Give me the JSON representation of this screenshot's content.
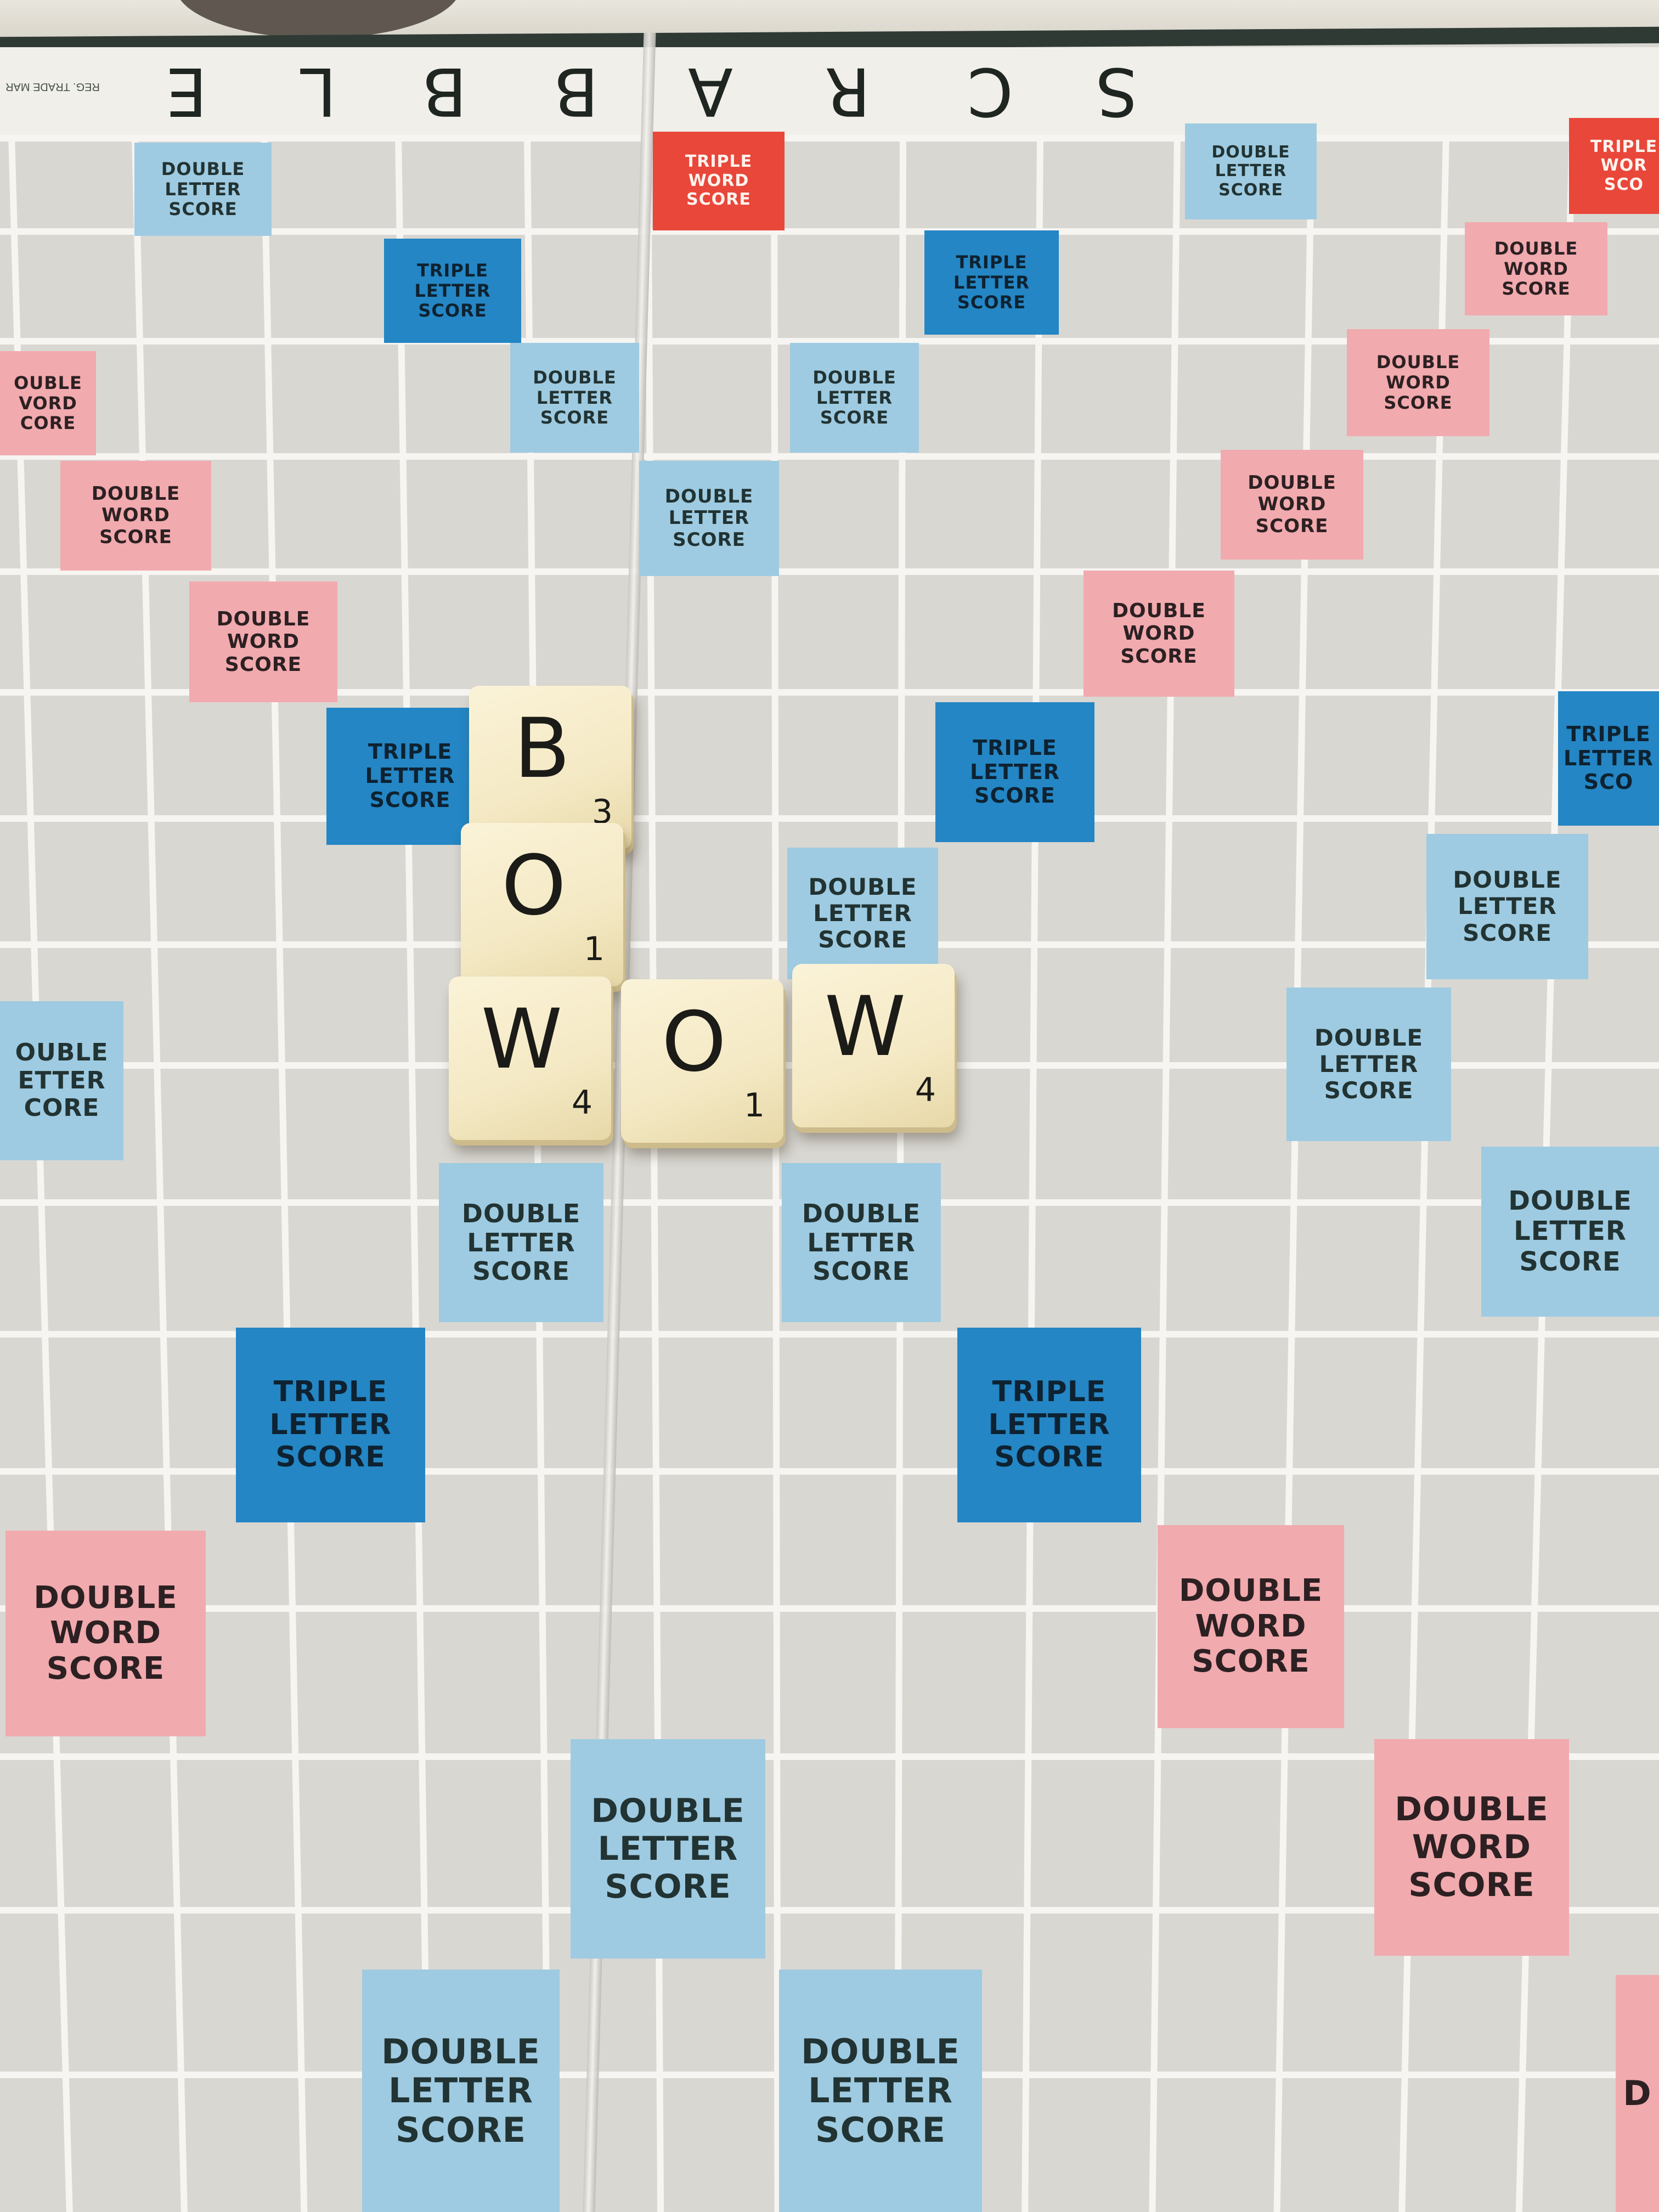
{
  "banner": {
    "letters": [
      "S",
      "C",
      "R",
      "A",
      "B",
      "B",
      "L",
      "E"
    ],
    "small_text": "REG. TRADE MAR"
  },
  "premium_squares": [
    {
      "type": "dl",
      "lines": [
        "DOUBLE",
        "LETTER",
        "SCORE"
      ]
    },
    {
      "type": "tw",
      "lines": [
        "TRIPLE",
        "WORD",
        "SCORE"
      ]
    },
    {
      "type": "dl",
      "lines": [
        "DOUBLE",
        "LETTER",
        "SCORE"
      ]
    },
    {
      "type": "tw",
      "lines": [
        "TRIPLE",
        "WOR",
        "SCO"
      ]
    },
    {
      "type": "tl",
      "lines": [
        "TRIPLE",
        "LETTER",
        "SCORE"
      ]
    },
    {
      "type": "tl",
      "lines": [
        "TRIPLE",
        "LETTER",
        "SCORE"
      ]
    },
    {
      "type": "dw",
      "lines": [
        "DOUBLE",
        "WORD",
        "SCORE"
      ]
    },
    {
      "type": "dw",
      "lines": [
        "OUBLE",
        "VORD",
        "CORE"
      ]
    },
    {
      "type": "dl",
      "lines": [
        "DOUBLE",
        "LETTER",
        "SCORE"
      ]
    },
    {
      "type": "dl",
      "lines": [
        "DOUBLE",
        "LETTER",
        "SCORE"
      ]
    },
    {
      "type": "dw",
      "lines": [
        "DOUBLE",
        "WORD",
        "SCORE"
      ]
    },
    {
      "type": "dw",
      "lines": [
        "DOUBLE",
        "WORD",
        "SCORE"
      ]
    },
    {
      "type": "dl",
      "lines": [
        "DOUBLE",
        "LETTER",
        "SCORE"
      ]
    },
    {
      "type": "dw",
      "lines": [
        "DOUBLE",
        "WORD",
        "SCORE"
      ]
    },
    {
      "type": "dw",
      "lines": [
        "DOUBLE",
        "WORD",
        "SCORE"
      ]
    },
    {
      "type": "dw",
      "lines": [
        "DOUBLE",
        "WORD",
        "SCORE"
      ]
    },
    {
      "type": "tl",
      "lines": [
        "TRIPLE",
        "LETTER",
        "SCORE"
      ]
    },
    {
      "type": "tl",
      "lines": [
        "TRIPLE",
        "LETTER",
        "SCORE"
      ]
    },
    {
      "type": "tl",
      "lines": [
        "TRIPLE",
        "LETTER",
        "SCO"
      ]
    },
    {
      "type": "dl",
      "lines": [
        "DOUBLE",
        "LETTER",
        "SCORE"
      ]
    },
    {
      "type": "dl",
      "lines": [
        "DOUBLE",
        "LETTER",
        "SCORE"
      ]
    },
    {
      "type": "dl",
      "lines": [
        "OUBLE",
        "ETTER",
        "CORE"
      ]
    },
    {
      "type": "dl",
      "lines": [
        "DOUBLE",
        "LETTER",
        "SCORE"
      ]
    },
    {
      "type": "dl",
      "lines": [
        "DOUBLE",
        "LETTER",
        "SCORE"
      ]
    },
    {
      "type": "dl",
      "lines": [
        "DOUBLE",
        "LETTER",
        "SCORE"
      ]
    },
    {
      "type": "dl",
      "lines": [
        "DOUBLE",
        "LETTER",
        "SCORE"
      ]
    },
    {
      "type": "tl",
      "lines": [
        "TRIPLE",
        "LETTER",
        "SCORE"
      ]
    },
    {
      "type": "tl",
      "lines": [
        "TRIPLE",
        "LETTER",
        "SCORE"
      ]
    },
    {
      "type": "dw",
      "lines": [
        "DOUBLE",
        "WORD",
        "SCORE"
      ]
    },
    {
      "type": "dw",
      "lines": [
        "DOUBLE",
        "WORD",
        "SCORE"
      ]
    },
    {
      "type": "dl",
      "lines": [
        "DOUBLE",
        "LETTER",
        "SCORE"
      ]
    },
    {
      "type": "dw",
      "lines": [
        "DOUBLE",
        "WORD",
        "SCORE"
      ]
    },
    {
      "type": "dl",
      "lines": [
        "DOUBLE",
        "LETTER",
        "SCORE"
      ]
    },
    {
      "type": "dl",
      "lines": [
        "DOUBLE",
        "LETTER",
        "SCORE"
      ]
    },
    {
      "type": "dw",
      "lines": [
        "D"
      ]
    }
  ],
  "tiles": [
    {
      "letter": "B",
      "score": "3"
    },
    {
      "letter": "O",
      "score": "1"
    },
    {
      "letter": "W",
      "score": "4"
    },
    {
      "letter": "O",
      "score": "1"
    },
    {
      "letter": "W",
      "score": "4"
    }
  ],
  "colors": {
    "double_letter": "#9ecbe1",
    "triple_letter": "#2486c4",
    "double_word": "#f1aaae",
    "triple_word": "#e8473a",
    "tile": "#f4e9c4"
  }
}
